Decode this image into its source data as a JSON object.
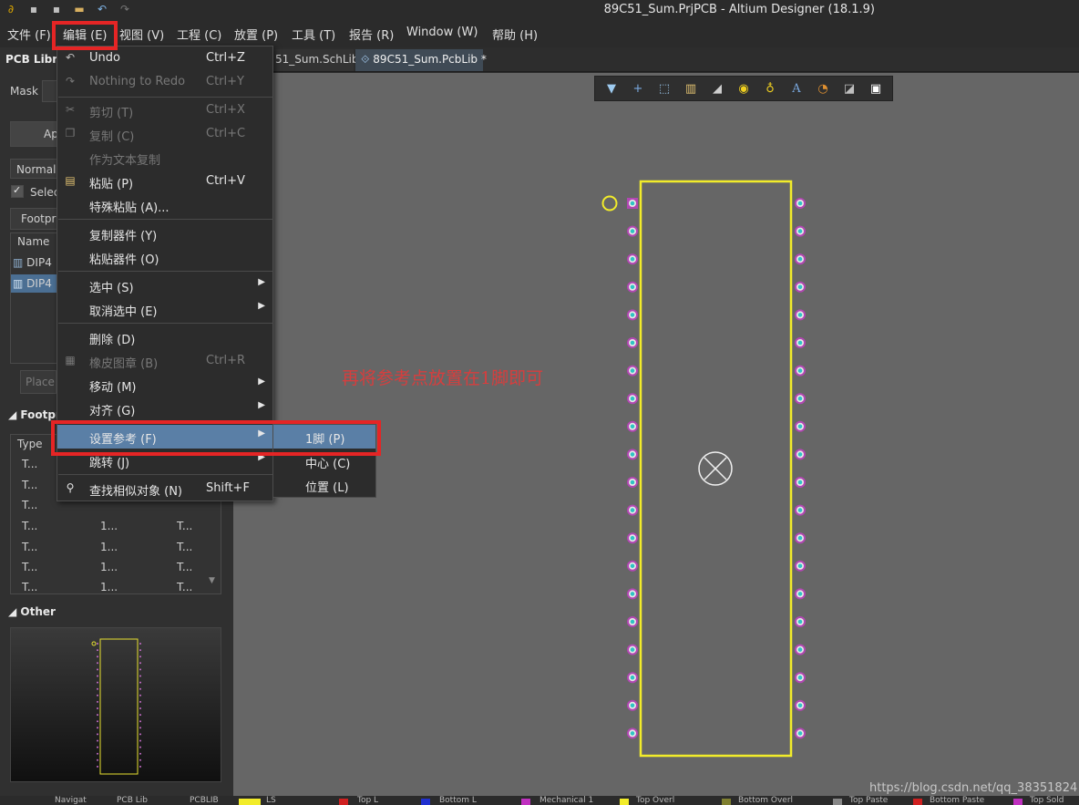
{
  "window": {
    "title": "89C51_Sum.PrjPCB - Altium Designer (18.1.9)"
  },
  "menubar": {
    "items": [
      {
        "label": "文件 (F)"
      },
      {
        "label": "编辑 (E)"
      },
      {
        "label": "视图 (V)"
      },
      {
        "label": "工程 (C)"
      },
      {
        "label": "放置 (P)"
      },
      {
        "label": "工具 (T)"
      },
      {
        "label": "报告 (R)"
      },
      {
        "label": "Window (W)"
      },
      {
        "label": "帮助 (H)"
      }
    ]
  },
  "tabs": [
    {
      "label": "51_Sum.SchLib"
    },
    {
      "label": "89C51_Sum.PcbLib *"
    }
  ],
  "left_panel": {
    "title": "PCB Libr",
    "mask_label": "Mask",
    "apply_label": "Ap",
    "normal_label": "Normal",
    "select_label": "Selec",
    "footprint_header": "Footpri",
    "name_header": "Name",
    "items": [
      "DIP4",
      "DIP4"
    ],
    "place_label": "Place",
    "footprint_section": "Footpr",
    "type_header": "Type",
    "table_rows": [
      [
        "T...",
        "1...",
        "T..."
      ],
      [
        "T...",
        "1...",
        "T..."
      ],
      [
        "T...",
        "1...",
        "T..."
      ],
      [
        "T...",
        "1...",
        "T..."
      ],
      [
        "T...",
        "1...",
        "T..."
      ],
      [
        "T...",
        "1...",
        "T..."
      ],
      [
        "T...",
        "1...",
        "T..."
      ]
    ],
    "other_section": "Other"
  },
  "edit_menu": {
    "items": [
      {
        "label": "Undo",
        "shortcut": "Ctrl+Z",
        "icon": "undo-icon",
        "disabled": false
      },
      {
        "label": "Nothing to Redo",
        "shortcut": "Ctrl+Y",
        "icon": "redo-icon",
        "disabled": true
      },
      {
        "label": "剪切 (T)",
        "shortcut": "Ctrl+X",
        "icon": "cut-icon",
        "disabled": true
      },
      {
        "label": "复制 (C)",
        "shortcut": "Ctrl+C",
        "icon": "copy-icon",
        "disabled": true
      },
      {
        "label": "作为文本复制",
        "shortcut": "",
        "icon": "",
        "disabled": true
      },
      {
        "label": "粘贴 (P)",
        "shortcut": "Ctrl+V",
        "icon": "paste-icon",
        "disabled": false
      },
      {
        "label": "特殊粘贴 (A)...",
        "shortcut": "",
        "icon": "",
        "disabled": false
      },
      {
        "label": "复制器件 (Y)",
        "shortcut": "",
        "icon": "",
        "disabled": false
      },
      {
        "label": "粘贴器件 (O)",
        "shortcut": "",
        "icon": "",
        "disabled": false
      },
      {
        "label": "选中 (S)",
        "shortcut": "",
        "icon": "",
        "disabled": false,
        "submenu": true
      },
      {
        "label": "取消选中 (E)",
        "shortcut": "",
        "icon": "",
        "disabled": false,
        "submenu": true
      },
      {
        "label": "删除 (D)",
        "shortcut": "",
        "icon": "",
        "disabled": false
      },
      {
        "label": "橡皮图章 (B)",
        "shortcut": "Ctrl+R",
        "icon": "rubber-stamp-icon",
        "disabled": true
      },
      {
        "label": "移动 (M)",
        "shortcut": "",
        "icon": "",
        "disabled": false,
        "submenu": true
      },
      {
        "label": "对齐 (G)",
        "shortcut": "",
        "icon": "",
        "disabled": false,
        "submenu": true
      },
      {
        "label": "设置参考 (F)",
        "shortcut": "",
        "icon": "",
        "disabled": false,
        "submenu": true,
        "highlighted": true
      },
      {
        "label": "跳转 (J)",
        "shortcut": "",
        "icon": "",
        "disabled": false,
        "submenu": true
      },
      {
        "label": "查找相似对象 (N)",
        "shortcut": "Shift+F",
        "icon": "find-icon",
        "disabled": false
      }
    ]
  },
  "submenu": {
    "items": [
      {
        "label": "1脚 (P)",
        "highlighted": true
      },
      {
        "label": "中心 (C)"
      },
      {
        "label": "位置 (L)"
      }
    ]
  },
  "annotation": "再将参考点放置在1脚即可",
  "watermark": "https://blog.csdn.net/qq_38351824",
  "status_bar": {
    "items": [
      "Navigat",
      "PCB Lib",
      "PCBLIB",
      "LS",
      "Top L",
      "Bottom L",
      "Mechanical 1",
      "Top Overl",
      "Bottom Overl",
      "Top Paste",
      "Bottom Paste",
      "Top Sold"
    ]
  },
  "colors": {
    "outline": "#f2ec2a",
    "pad_ring": "#b247b3",
    "pad_hole": "#2ec4c4",
    "highlight": "#5a7fa6",
    "callout": "#e52525"
  },
  "pcb": {
    "pins_per_side": 20,
    "component": "DIP40"
  }
}
